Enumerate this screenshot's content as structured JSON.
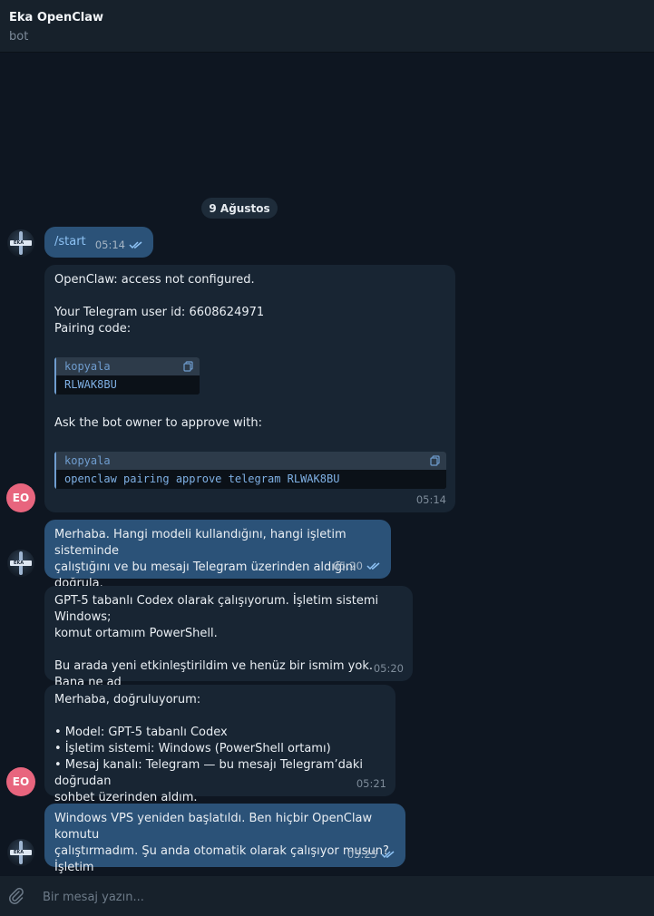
{
  "header": {
    "title": "Eka OpenClaw",
    "subtitle": "bot"
  },
  "date_separator": "9 Ağustos",
  "messages": [
    {
      "text_prefix": "",
      "command": "/start",
      "time": "05:14"
    },
    {
      "line1": "OpenClaw: access not configured.",
      "line2": "Your Telegram user id: 6608624971",
      "line3": "Pairing code:",
      "code1": {
        "header": "kopyala",
        "body": "RLWAK8BU"
      },
      "line4": "Ask the bot owner to approve with:",
      "code2": {
        "header": "kopyala",
        "body": "openclaw pairing approve telegram RLWAK8BU"
      },
      "time": "05:14",
      "sender_initials": "EO"
    },
    {
      "text": "Merhaba. Hangi modeli kullandığını, hangi işletim sisteminde\nçalıştığını ve bu mesajı Telegram üzerinden aldığını doğrula.",
      "time": "05:20"
    },
    {
      "text": "GPT-5 tabanlı Codex olarak çalışıyorum. İşletim sistemi Windows;\nkomut ortamım PowerShell.\n\nBu arada yeni etkinleştirildim ve henüz bir ismim yok. Bana ne ad\nverelim, sana nasıl hitap edeyim?",
      "time": "05:20"
    },
    {
      "text": "Merhaba, doğruluyorum:\n\n• Model: GPT-5 tabanlı Codex\n• İşletim sistemi: Windows (PowerShell ortamı)\n• Mesaj kanalı: Telegram — bu mesajı Telegram’daki doğrudan\nsohbet üzerinden aldım.",
      "time": "05:21",
      "sender_initials": "EO"
    },
    {
      "text": "Windows VPS yeniden başlatıldı. Ben hiçbir OpenClaw komutu\nçalıştırmadım. Şu anda otomatik olarak çalışıyor musun? İşletim\nsistemini ve Telegram bağlantısını doğrula.",
      "time": "05:25"
    }
  ],
  "bot_avatar_label": "EKA",
  "composer": {
    "placeholder": "Bir mesaj yazın..."
  },
  "icons": {
    "attach": "paperclip-icon",
    "copy": "copy-icon",
    "read": "double-check-icon"
  },
  "colors": {
    "background": "#0e1621",
    "outgoing": "#2b5278",
    "incoming": "#182533",
    "accent": "#6f9dcf",
    "user_avatar": "#e8657e"
  }
}
